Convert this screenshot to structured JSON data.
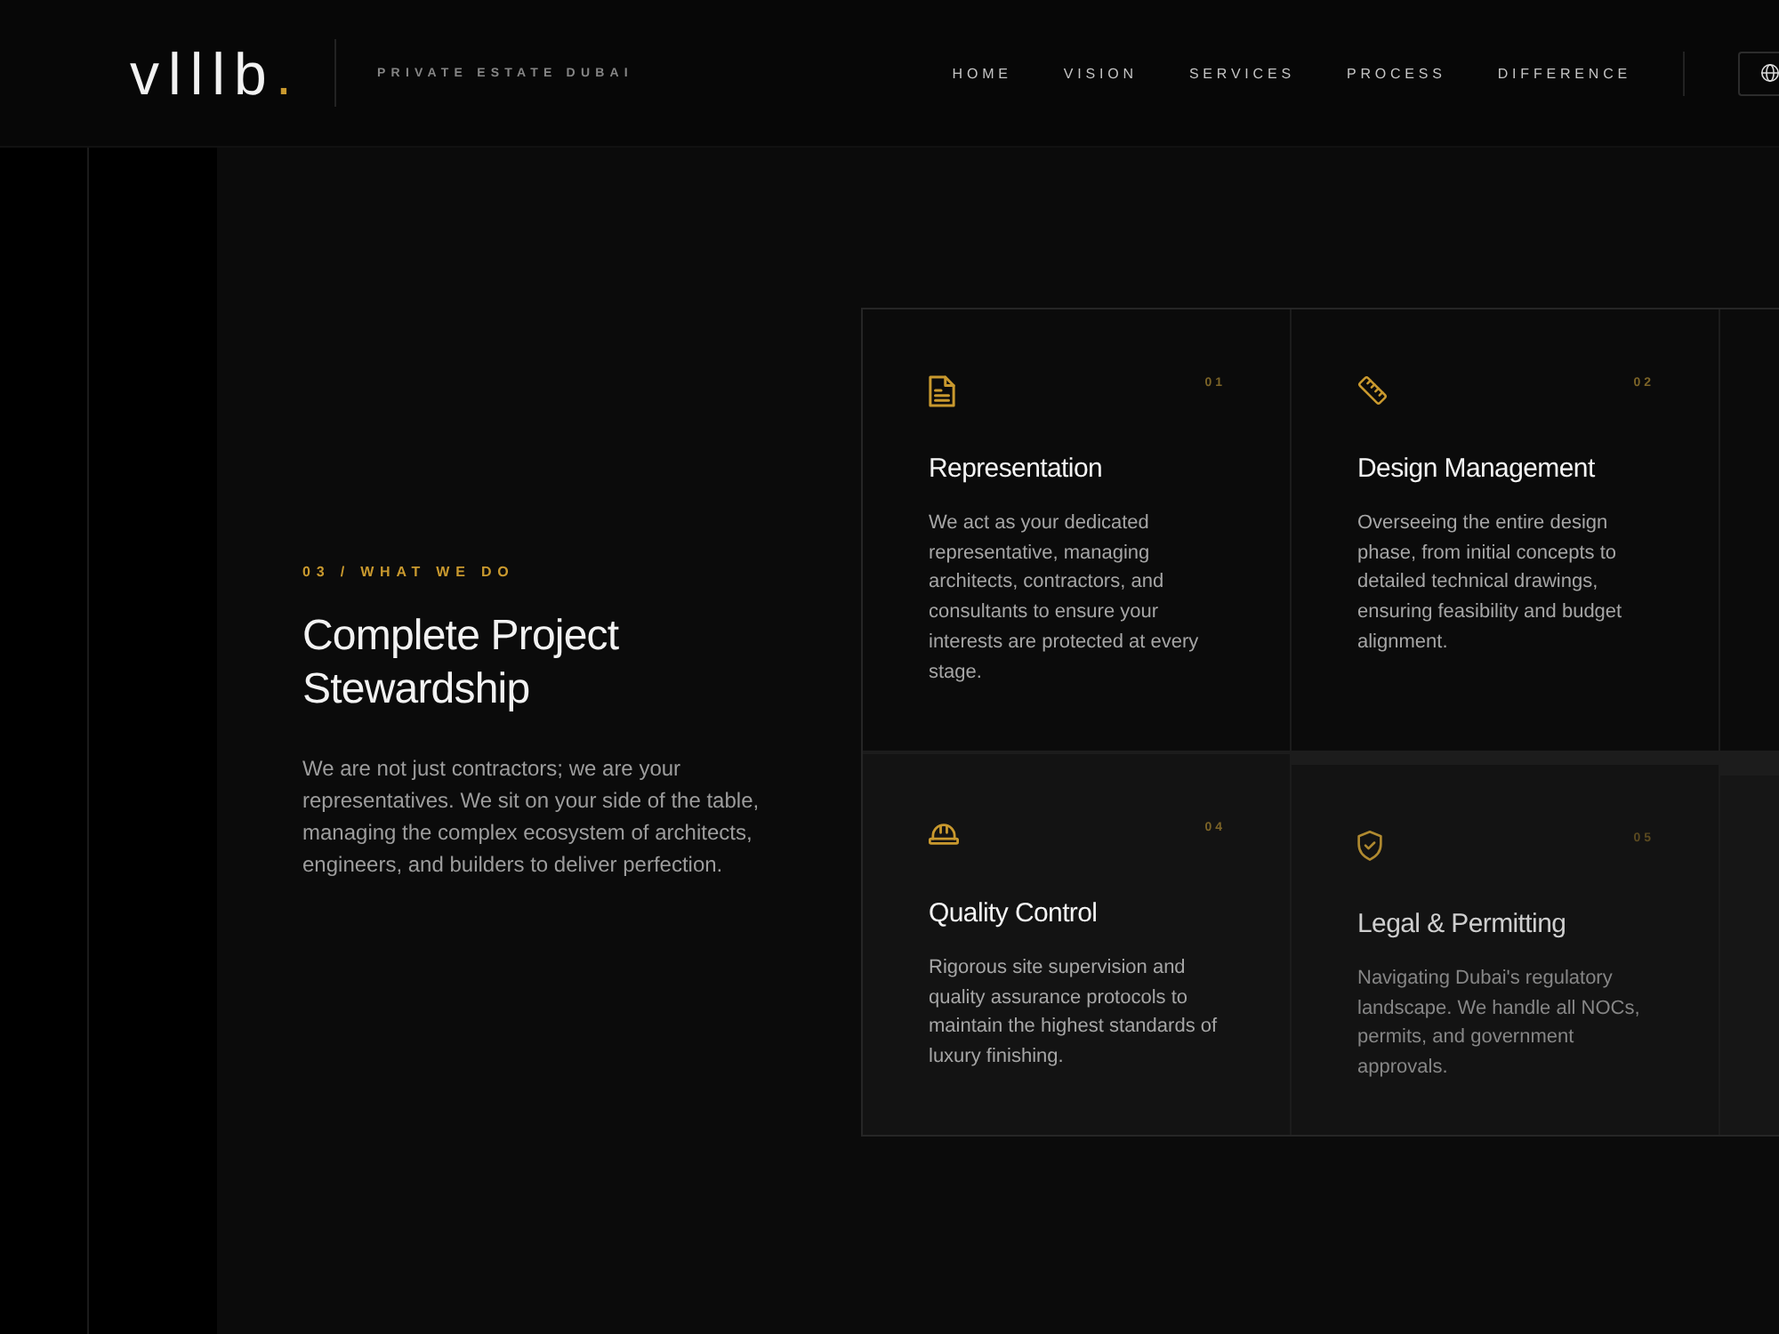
{
  "header": {
    "logo": {
      "text": "vlllb",
      "mark": "."
    },
    "tagline": "PRIVATE ESTATE DUBAI",
    "nav": [
      {
        "label": "HOME"
      },
      {
        "label": "VISION"
      },
      {
        "label": "SERVICES"
      },
      {
        "label": "PROCESS"
      },
      {
        "label": "DIFFERENCE"
      }
    ]
  },
  "services": {
    "eyebrow": "03 / WHAT WE DO",
    "heading": "Complete Project Stewardship",
    "body": "We are not just contractors; we are your representatives. We sit on your side of the table, managing the complex ecosystem of architects, engineers, and builders to deliver perfection.",
    "card_rows": [
      [
        {
          "number": "01",
          "title": "Representation",
          "description": "We act as your dedicated representative, managing architects, contractors, and consultants to ensure your interests are protected at every stage.",
          "dimmed": false
        },
        {
          "number": "02",
          "title": "Design Management",
          "description": "Overseeing the entire design phase, from initial concepts to detailed technical drawings, ensuring feasibility and budget alignment.",
          "dimmed": false
        }
      ],
      [
        {
          "number": "04",
          "title": "Quality Control",
          "description": "Rigorous site supervision and quality assurance protocols to maintain the highest standards of luxury finishing.",
          "dimmed": false
        },
        {
          "number": "05",
          "title": "Legal & Permitting",
          "description": "Navigating Dubai's regulatory landscape. We handle all NOCs, permits, and government approvals.",
          "dimmed": true
        }
      ]
    ]
  }
}
